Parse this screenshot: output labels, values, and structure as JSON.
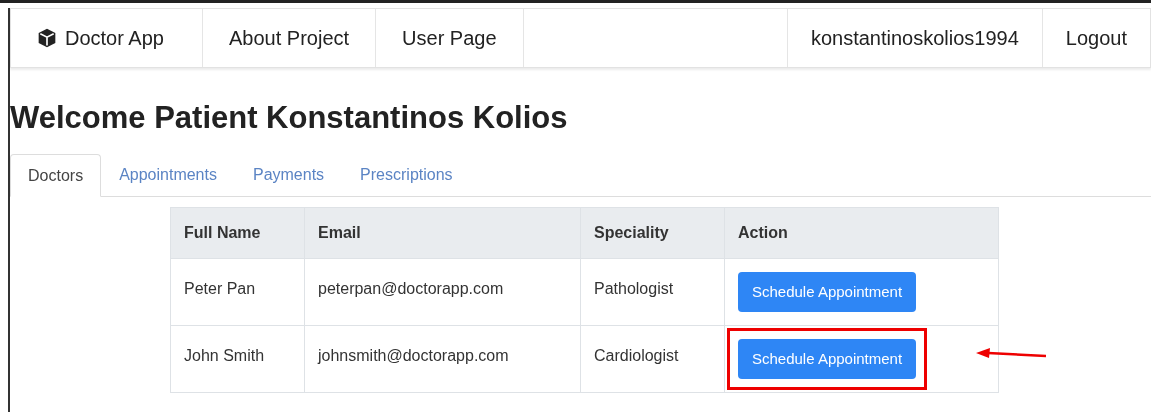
{
  "navbar": {
    "brand": "Doctor App",
    "links": [
      "About Project",
      "User Page"
    ],
    "right_links": [
      "konstantinoskolios1994",
      "Logout"
    ]
  },
  "heading": "Welcome Patient Konstantinos Kolios",
  "tabs": [
    {
      "label": "Doctors",
      "selected": true
    },
    {
      "label": "Appointments",
      "selected": false
    },
    {
      "label": "Payments",
      "selected": false
    },
    {
      "label": "Prescriptions",
      "selected": false
    }
  ],
  "table": {
    "columns": [
      "Full Name",
      "Email",
      "Speciality",
      "Action"
    ],
    "rows": [
      {
        "full_name": "Peter Pan",
        "email": "peterpan@doctorapp.com",
        "speciality": "Pathologist",
        "action": "Schedule Appointment",
        "highlighted": false
      },
      {
        "full_name": "John Smith",
        "email": "johnsmith@doctorapp.com",
        "speciality": "Cardiologist",
        "action": "Schedule Appointment",
        "highlighted": true
      }
    ]
  }
}
